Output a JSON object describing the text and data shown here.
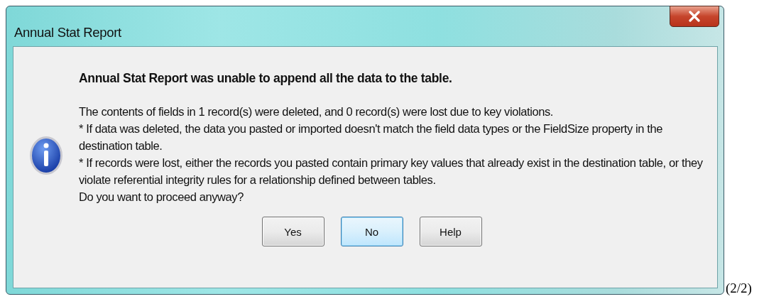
{
  "window": {
    "title": "Annual Stat Report"
  },
  "message": {
    "kind": "info",
    "heading": "Annual Stat Report was unable to append all the data to the table.",
    "lines": [
      "The contents of fields in 1 record(s) were deleted, and 0 record(s) were lost due to key violations.",
      "* If data was deleted, the data you pasted or imported doesn't match the field data types or the FieldSize property in the destination table.",
      "* If records were lost, either the records you pasted contain primary key values that already exist in the destination table, or they violate referential integrity rules for a relationship defined between tables.",
      "Do you want to proceed anyway?"
    ]
  },
  "buttons": [
    {
      "label": "Yes",
      "default": false
    },
    {
      "label": "No",
      "default": true
    },
    {
      "label": "Help",
      "default": false
    }
  ],
  "page_counter": "(2/2)"
}
